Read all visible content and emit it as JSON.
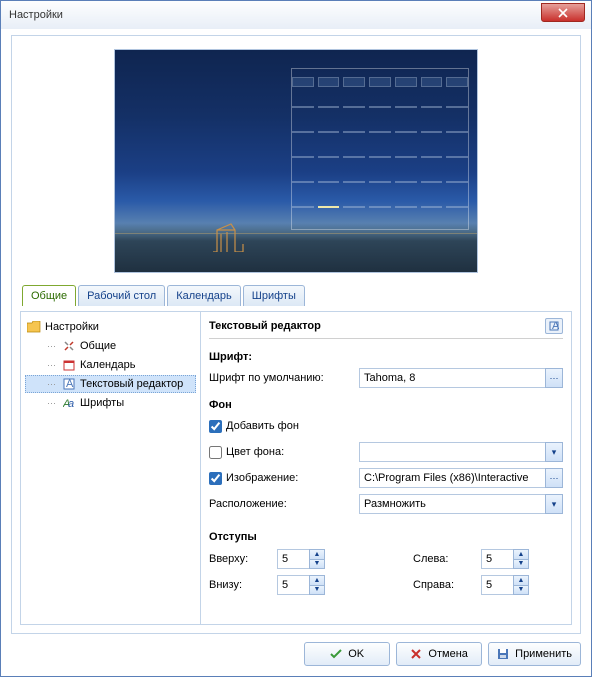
{
  "window": {
    "title": "Настройки"
  },
  "tabs": {
    "t1": "Общие",
    "t2": "Рабочий стол",
    "t3": "Календарь",
    "t4": "Шрифты"
  },
  "tree": {
    "root": "Настройки",
    "n1": "Общие",
    "n2": "Календарь",
    "n3": "Текстовый редактор",
    "n4": "Шрифты"
  },
  "form": {
    "title": "Текстовый редактор",
    "font_section": "Шрифт:",
    "font_default_label": "Шрифт по умолчанию:",
    "font_default_value": "Tahoma, 8",
    "bg_section": "Фон",
    "add_bg_label": "Добавить фон",
    "bg_color_label": "Цвет фона:",
    "image_label": "Изображение:",
    "image_value": "C:\\Program Files (x86)\\Interactive",
    "layout_label": "Расположение:",
    "layout_value": "Размножить",
    "margins_section": "Отступы",
    "m_top": "Вверху:",
    "m_bottom": "Внизу:",
    "m_left": "Слева:",
    "m_right": "Справа:",
    "v_top": "5",
    "v_bottom": "5",
    "v_left": "5",
    "v_right": "5"
  },
  "buttons": {
    "ok": "OK",
    "cancel": "Отмена",
    "apply": "Применить"
  }
}
